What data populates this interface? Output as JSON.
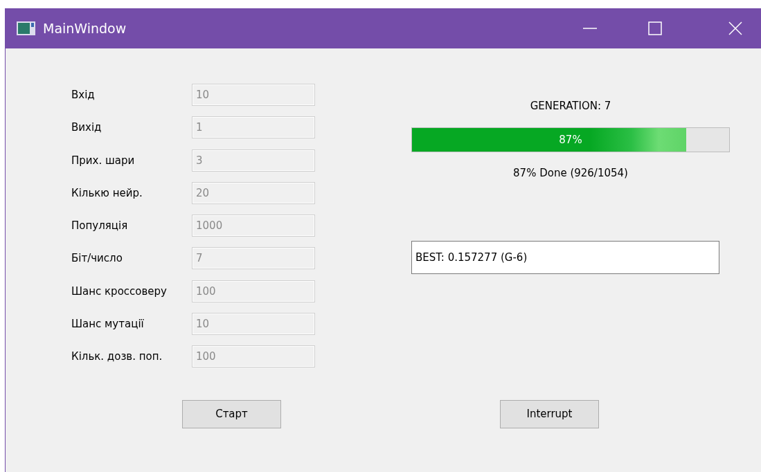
{
  "window": {
    "title": "MainWindow"
  },
  "fields": [
    {
      "label": "Вхід",
      "value": "10",
      "disabled": true
    },
    {
      "label": "Вихід",
      "value": "1",
      "disabled": true
    },
    {
      "label": "Прих. шари",
      "value": "3",
      "disabled": true
    },
    {
      "label": "Кількю нейр.",
      "value": "20",
      "disabled": true
    },
    {
      "label": "Популяція",
      "value": "1000",
      "disabled": true
    },
    {
      "label": "Біт/число",
      "value": "7",
      "disabled": true
    },
    {
      "label": "Шанс кроссоверу",
      "value": "100",
      "disabled": true
    },
    {
      "label": "Шанс мутації",
      "value": "10",
      "disabled": true
    },
    {
      "label": "Кільк. дозв. поп.",
      "value": "100",
      "disabled": true
    }
  ],
  "generation": "GENERATION: 7",
  "progress": {
    "level": 0.865,
    "text": "87%"
  },
  "progress_status": "87% Done (926/1054)",
  "best": {
    "value": "BEST: 0.157277 (G-6)"
  },
  "buttons": [
    {
      "label": "Старт"
    },
    {
      "label": "Interrupt"
    }
  ]
}
